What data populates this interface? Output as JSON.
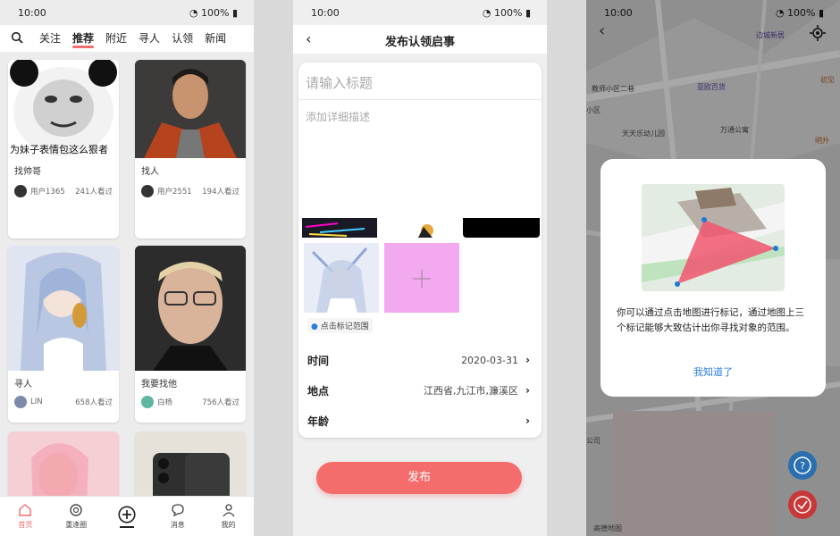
{
  "status": {
    "time": "10:00",
    "battery": "100%"
  },
  "feed_screen": {
    "tabs": [
      "关注",
      "推荐",
      "附近",
      "寻人",
      "认领",
      "新闻"
    ],
    "active_tab": "推荐",
    "cards": [
      {
        "image_text": "为妹子表情包这么狠者",
        "title": "找帅哥",
        "user": "用户1365",
        "views": "241人看过"
      },
      {
        "title": "找人",
        "user": "用户2551",
        "views": "194人看过"
      },
      {
        "title": "寻人",
        "user": "LIN",
        "views": "658人看过"
      },
      {
        "title": "我要找他",
        "user": "白杨",
        "views": "756人看过"
      }
    ],
    "bottom_nav": [
      {
        "label": "首页",
        "icon": "home-icon"
      },
      {
        "label": "重逢圈",
        "icon": "circle-icon"
      },
      {
        "label": "",
        "icon": "add-icon"
      },
      {
        "label": "消息",
        "icon": "message-icon"
      },
      {
        "label": "我的",
        "icon": "profile-icon"
      }
    ]
  },
  "publish_screen": {
    "title": "发布认领启事",
    "title_placeholder": "请输入标题",
    "desc_placeholder": "添加详细描述",
    "map_mark": "点击标记范围",
    "rows": [
      {
        "label": "时间",
        "value": "2020-03-31"
      },
      {
        "label": "地点",
        "value": "江西省,九江市,濂溪区"
      },
      {
        "label": "年龄",
        "value": ""
      }
    ],
    "publish_label": "发布",
    "accent": "#f56c6c",
    "add_tile_color": "#f3a9ef"
  },
  "map_screen": {
    "pois": [
      "边城新居",
      "亚欧百货",
      "初见",
      "教师小区二巷",
      "小区",
      "天天乐幼儿园",
      "万通公寓",
      "明升",
      "公司",
      "高德地图"
    ],
    "modal_text": "你可以通过点击地图进行标记，通过地图上三个标记能够大致估计出你寻找对象的范围。",
    "modal_button": "我知道了",
    "fab_colors": {
      "help": "#2a6fb0",
      "confirm": "#c93838"
    }
  }
}
